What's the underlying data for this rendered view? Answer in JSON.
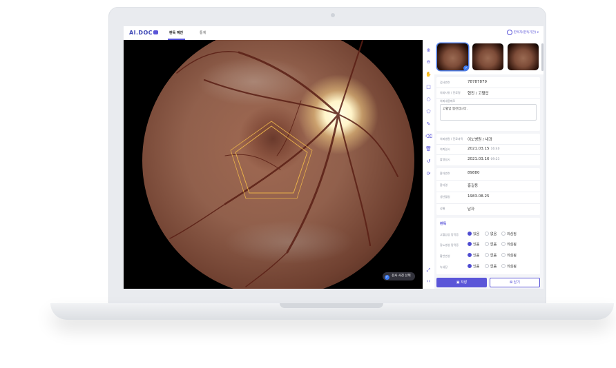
{
  "app": {
    "logo_text": "AI.DOC"
  },
  "nav": {
    "tabs": [
      {
        "label": "판독 예진"
      },
      {
        "label": "통계"
      }
    ],
    "user_label": "판독자(판독기관) ▾"
  },
  "viewer": {
    "chip_label": "검사 사진 선택"
  },
  "toolbar": {
    "icons": [
      "zoom-in-icon",
      "zoom-out-icon",
      "hand-icon",
      "rectangle-icon",
      "circle-icon",
      "polygon-icon",
      "pen-icon",
      "eraser-icon",
      "trash-icon",
      "undo-icon",
      "reset-icon",
      "fullscreen-icon",
      "collapse-icon"
    ]
  },
  "patient": {
    "exam_no_label": "검사번호",
    "exam_no": "78787879",
    "diagnosis_label": "의뢰사유 / 진료명",
    "diagnosis": "협진 / 고혈압",
    "memo_label": "의뢰내용메모",
    "memo": "고혈압 협진입니다.",
    "hospital_label": "의뢰병원 / 진료과목",
    "hospital": "이노병원 / 내과",
    "request_date_label": "의뢰일시",
    "request_date": "2021.03.15",
    "request_time": "16:40",
    "exam_date_label": "촬영일시",
    "exam_date": "2021.03.16",
    "exam_time": "09:23",
    "patient_no_label": "환자번호",
    "patient_no": "89880",
    "name_label": "환자명",
    "name": "홍길동",
    "birth_label": "생년월일",
    "birth": "1983.08.25",
    "sex_label": "성별",
    "sex": "남자"
  },
  "findings": {
    "title": "판독",
    "rows": [
      {
        "label": "고혈압성 망막증",
        "options": [
          "있음",
          "없음",
          "의심됨"
        ],
        "selected": 0
      },
      {
        "label": "당뇨병성 망막증",
        "options": [
          "있음",
          "없음",
          "의심됨"
        ],
        "selected": 0
      },
      {
        "label": "황반변성",
        "options": [
          "있음",
          "없음",
          "의심됨"
        ],
        "selected": 0
      },
      {
        "label": "녹내장",
        "options": [
          "있음",
          "없음",
          "의심됨"
        ],
        "selected": 0
      }
    ]
  },
  "actions": {
    "save_label": "저장",
    "close_label": "닫기"
  }
}
